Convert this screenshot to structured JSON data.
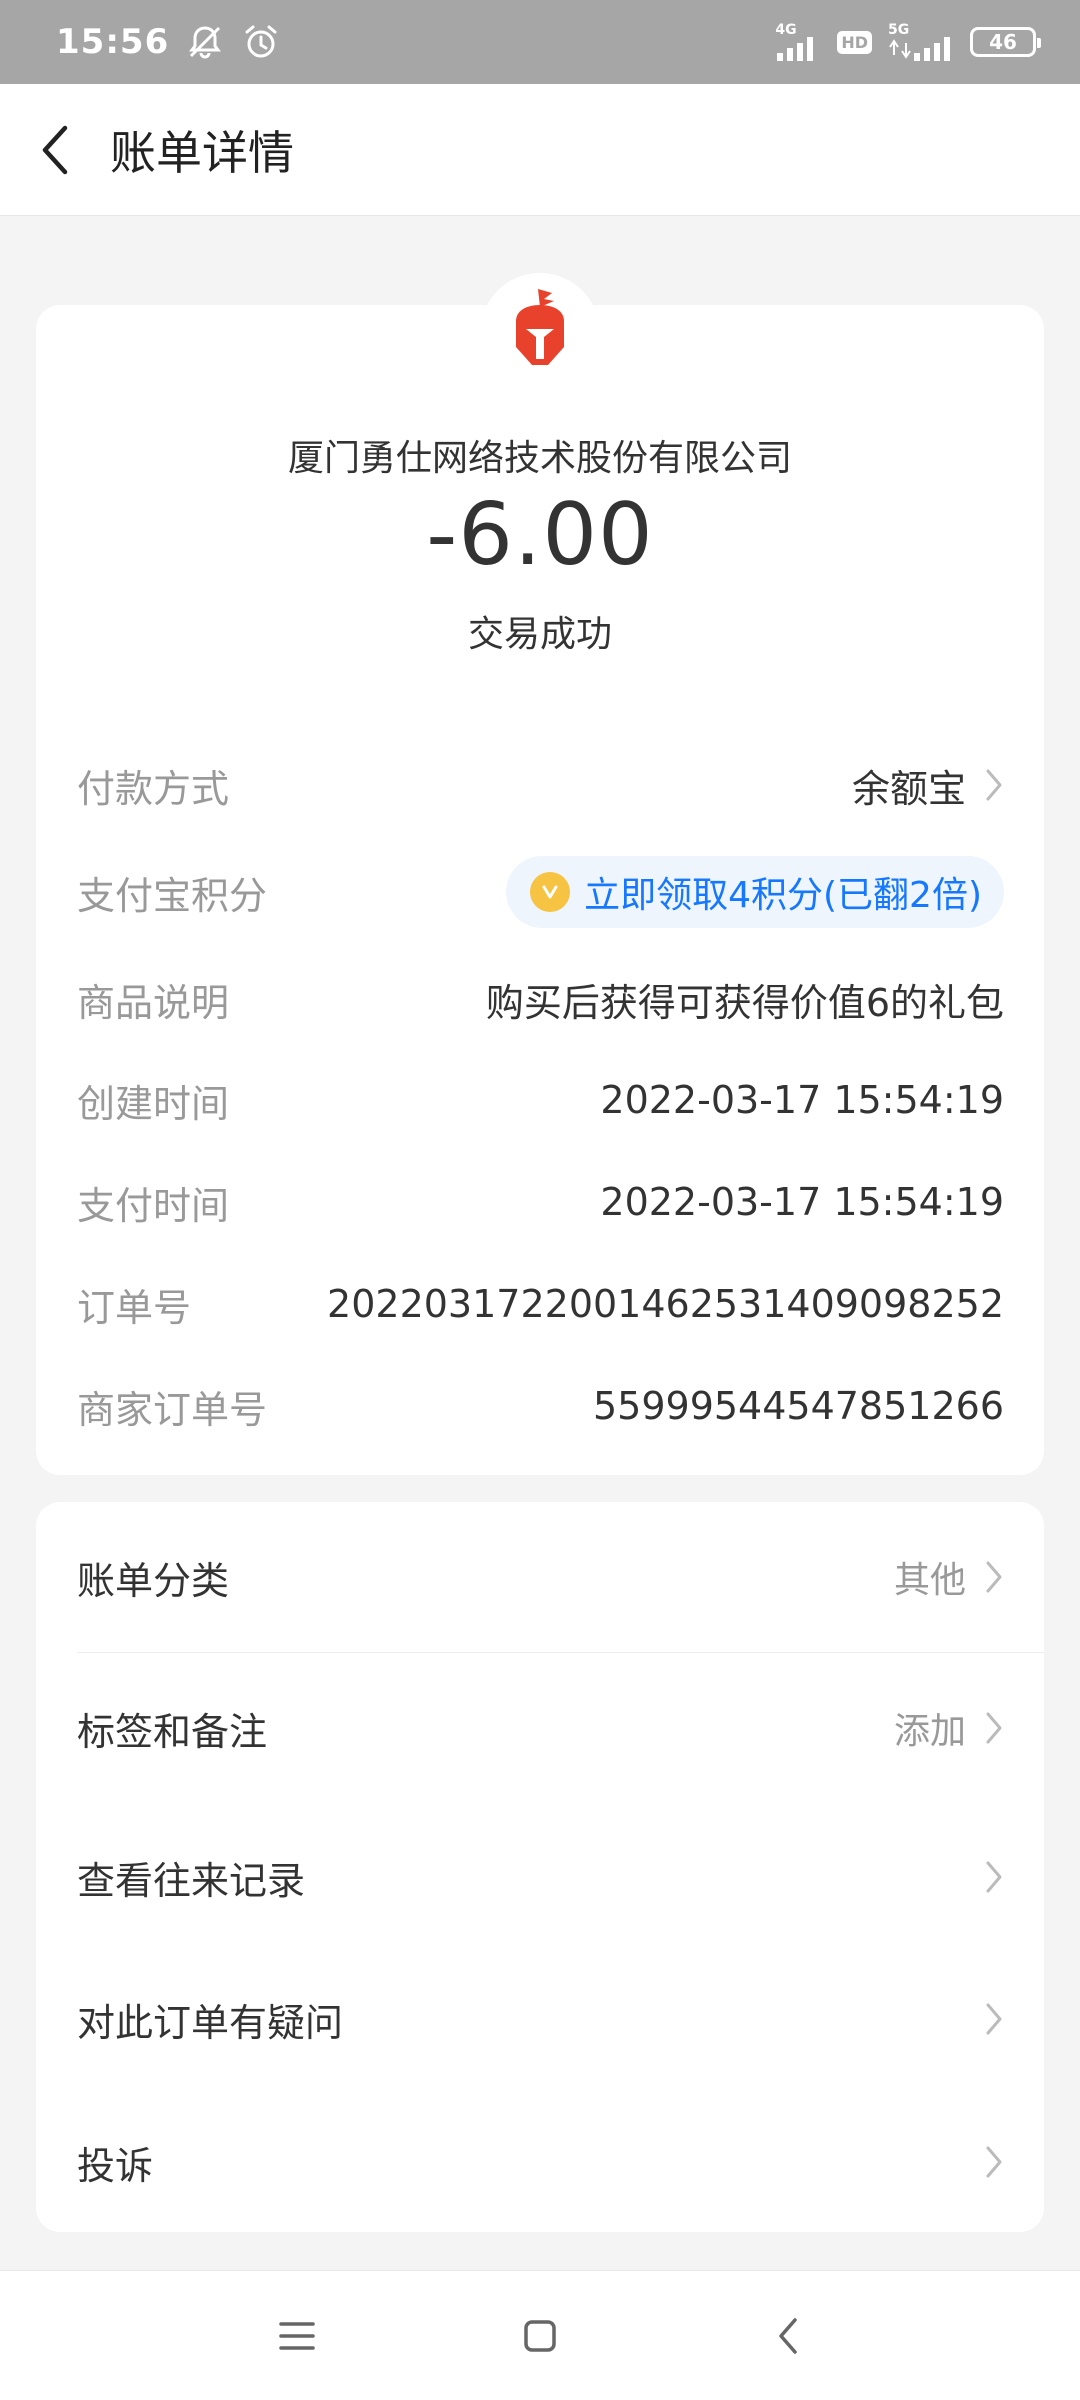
{
  "status_bar": {
    "time": "15:56",
    "net1_label": "4G",
    "hd_label": "HD",
    "net2_label": "5G",
    "battery": "46"
  },
  "header": {
    "title": "账单详情"
  },
  "bill": {
    "merchant": "厦门勇仕网络技术股份有限公司",
    "amount": "-6.00",
    "status": "交易成功",
    "details": {
      "payment_method": {
        "label": "付款方式",
        "value": "余额宝"
      },
      "points": {
        "label": "支付宝积分",
        "value": "立即领取4积分(已翻2倍)"
      },
      "product": {
        "label": "商品说明",
        "value": "购买后获得可获得价值6的礼包"
      },
      "created": {
        "label": "创建时间",
        "value": "2022-03-17 15:54:19"
      },
      "paid": {
        "label": "支付时间",
        "value": "2022-03-17 15:54:19"
      },
      "order_no": {
        "label": "订单号",
        "value": "2022031722001462531409098252"
      },
      "merchant_order_no": {
        "label": "商家订单号",
        "value": "55999544547851266"
      }
    }
  },
  "menu": {
    "category": {
      "label": "账单分类",
      "value": "其他"
    },
    "tags": {
      "label": "标签和备注",
      "value": "添加"
    },
    "history": {
      "label": "查看往来记录"
    },
    "question": {
      "label": "对此订单有疑问"
    },
    "complaint": {
      "label": "投诉"
    }
  },
  "colors": {
    "accent_blue": "#1677ff",
    "logo_red": "#e8412c",
    "coin_gold": "#f6c343"
  }
}
